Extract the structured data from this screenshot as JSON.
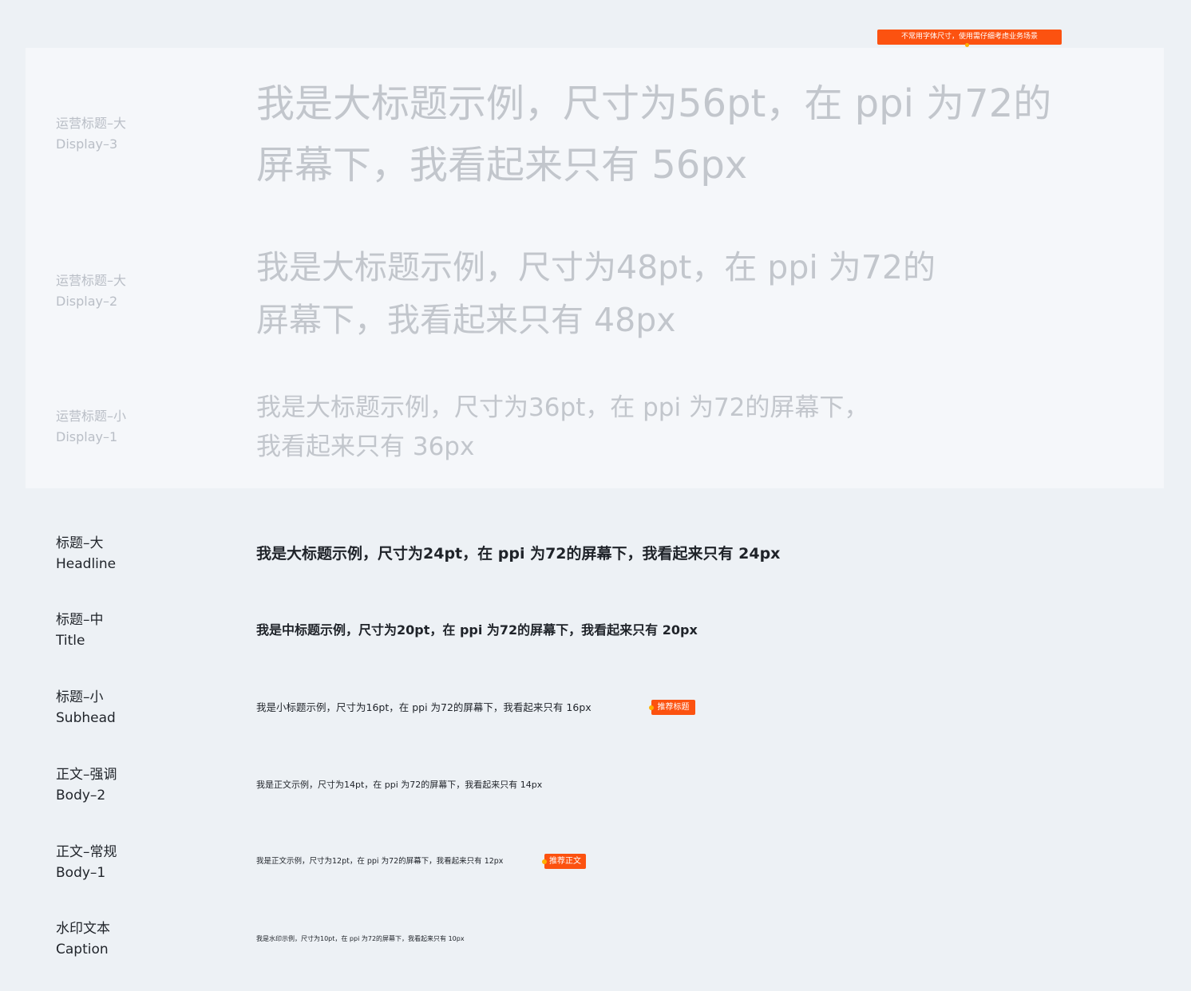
{
  "top_tag": "不常用字体尺寸，使用需仔细考虑业务场景",
  "display_rows": [
    {
      "zh": "运营标题–大",
      "en": "Display–3",
      "lines": [
        "我是大标题示例，尺寸为56pt，在 ppi 为72的",
        "屏幕下，我看起来只有 56px"
      ]
    },
    {
      "zh": "运营标题–大",
      "en": "Display–2",
      "lines": [
        "我是大标题示例，尺寸为48pt，在 ppi 为72的",
        "屏幕下，我看起来只有 48px"
      ]
    },
    {
      "zh": "运营标题–小",
      "en": "Display–1",
      "lines": [
        "我是大标题示例，尺寸为36pt，在 ppi 为72的屏幕下，",
        "我看起来只有 36px"
      ]
    }
  ],
  "text_rows": [
    {
      "zh": "标题–大",
      "en": "Headline",
      "sample": "我是大标题示例，尺寸为24pt，在 ppi 为72的屏幕下，我看起来只有 24px"
    },
    {
      "zh": "标题–中",
      "en": "Title",
      "sample": "我是中标题示例，尺寸为20pt，在 ppi 为72的屏幕下，我看起来只有 20px"
    },
    {
      "zh": "标题–小",
      "en": "Subhead",
      "sample": "我是小标题示例，尺寸为16pt，在 ppi 为72的屏幕下，我看起来只有 16px",
      "tag": "推荐标题"
    },
    {
      "zh": "正文–强调",
      "en": "Body–2",
      "sample": "我是正文示例，尺寸为14pt，在 ppi 为72的屏幕下，我看起来只有 14px"
    },
    {
      "zh": "正文–常规",
      "en": "Body–1",
      "sample": "我是正文示例，尺寸为12pt，在 ppi 为72的屏幕下，我看起来只有 12px",
      "tag": "推荐正文"
    },
    {
      "zh": "水印文本",
      "en": "Caption",
      "sample": "我是水印示例，尺寸为10pt，在 ppi 为72的屏幕下，我看起来只有 10px"
    }
  ],
  "colors": {
    "background": "#edf1f5",
    "panel": "#f5f7fa",
    "tag": "#fc5210",
    "text": "#1f2329",
    "faint": "#c2c6cc"
  }
}
